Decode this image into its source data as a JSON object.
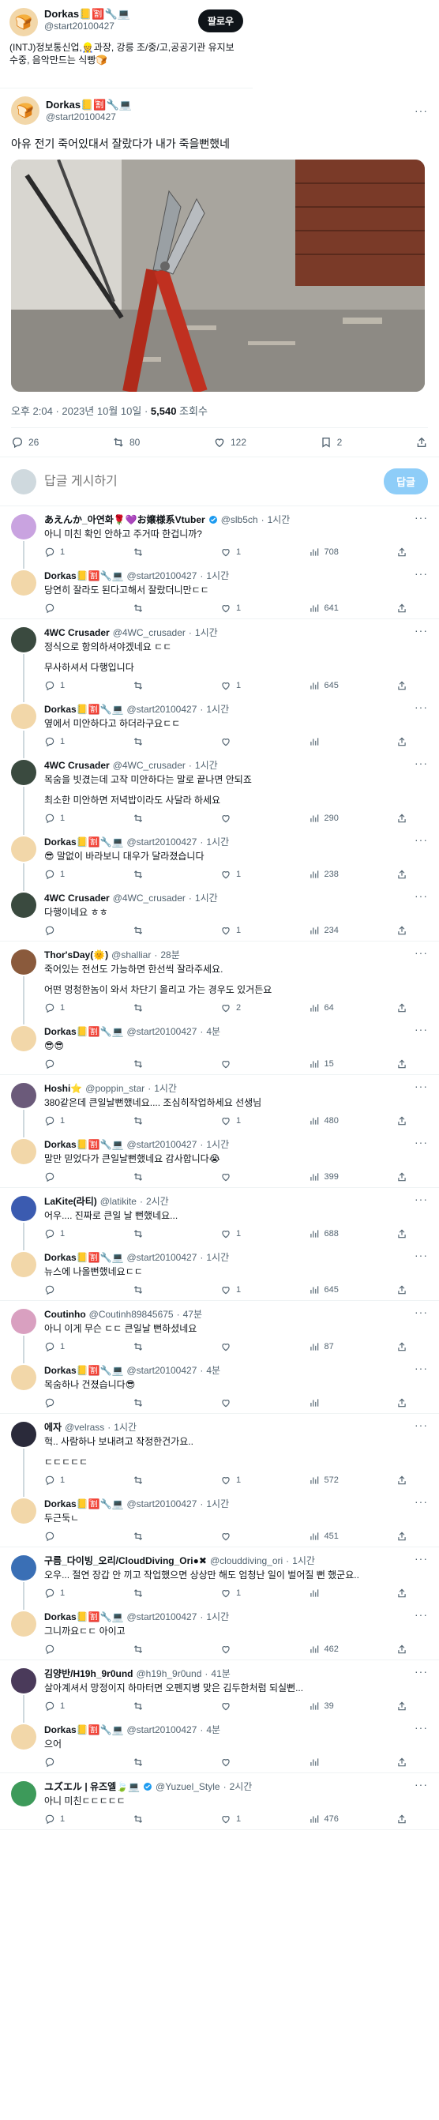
{
  "profile_card": {
    "name": "Dorkas📒🈹🔧💻",
    "handle": "@start20100427",
    "follow_label": "팔로우",
    "bio": "(INTJ)정보통신업,👷과장, 강릉 조/중/고,공공기관 유지보수중, 음악만드는 식빵🍞"
  },
  "main_tweet": {
    "name": "Dorkas📒🈹🔧💻",
    "handle": "@start20100427",
    "text": "아유 전기 죽어있대서 잘랐다가 내가 죽을뻔했네",
    "time": "오후 2:04 · 2023년 10월 10일 · ",
    "views": "5,540",
    "views_label": " 조회수",
    "stats": {
      "replies": "26",
      "retweets": "80",
      "likes": "122",
      "bookmarks": "2"
    }
  },
  "reply_box": {
    "placeholder": "답글 게시하기",
    "button": "답글"
  },
  "replies": [
    {
      "name": "あえんか_아연화🌹💜お嬢様系Vtuber",
      "verified": true,
      "handle": "@slb5ch",
      "time": "1시간",
      "body": [
        "아니 미친 확인 안하고 주거따 한겁니까?"
      ],
      "replies": "1",
      "retweets": "",
      "likes": "1",
      "views": "708",
      "color": "#c9a3e0",
      "threaded": true
    },
    {
      "name": "Dorkas📒🈹🔧💻",
      "verified": false,
      "handle": "@start20100427",
      "time": "1시간",
      "body": [
        "당연히 잘라도 된다고해서 잘랐더니만ㄷㄷ"
      ],
      "replies": "",
      "retweets": "",
      "likes": "1",
      "views": "641",
      "color": "#f2d7a9",
      "threaded": false
    },
    {
      "name": "4WC Crusader",
      "verified": false,
      "handle": "@4WC_crusader",
      "time": "1시간",
      "body": [
        "정식으로 항의하셔야겠네요 ㄷㄷ",
        "무사하셔서 다행입니다"
      ],
      "replies": "1",
      "retweets": "",
      "likes": "1",
      "views": "645",
      "color": "#3a4a3f",
      "threaded": true
    },
    {
      "name": "Dorkas📒🈹🔧💻",
      "verified": false,
      "handle": "@start20100427",
      "time": "1시간",
      "body": [
        "옆에서 미안하다고 하더라구요ㄷㄷ"
      ],
      "replies": "1",
      "retweets": "",
      "likes": "",
      "views": "",
      "color": "#f2d7a9",
      "threaded": true
    },
    {
      "name": "4WC Crusader",
      "verified": false,
      "handle": "@4WC_crusader",
      "time": "1시간",
      "body": [
        "목숨을 빗겼는데 고작 미안하다는 말로 끝나면 안되죠",
        "최소한 미안하면 저녁밥이라도 사달라 하세요"
      ],
      "replies": "1",
      "retweets": "",
      "likes": "",
      "views": "290",
      "color": "#3a4a3f",
      "threaded": true
    },
    {
      "name": "Dorkas📒🈹🔧💻",
      "verified": false,
      "handle": "@start20100427",
      "time": "1시간",
      "body": [
        "😎 말없이 바라보니 대우가 달라졌습니다"
      ],
      "replies": "1",
      "retweets": "",
      "likes": "1",
      "views": "238",
      "color": "#f2d7a9",
      "threaded": true
    },
    {
      "name": "4WC Crusader",
      "verified": false,
      "handle": "@4WC_crusader",
      "time": "1시간",
      "body": [
        "다행이네요 ㅎㅎ"
      ],
      "replies": "",
      "retweets": "",
      "likes": "1",
      "views": "234",
      "color": "#3a4a3f",
      "threaded": false
    },
    {
      "name": "Thor'sDay(🌞)",
      "verified": false,
      "handle": "@shalliar",
      "time": "28분",
      "body": [
        "죽어있는 전선도 가능하면 한선씩 잘라주세요.",
        "어떤 멍청한놈이 와서 차단기 올리고 가는 경우도 있거든요"
      ],
      "replies": "1",
      "retweets": "",
      "likes": "2",
      "views": "64",
      "color": "#8a5a3c",
      "threaded": true
    },
    {
      "name": "Dorkas📒🈹🔧💻",
      "verified": false,
      "handle": "@start20100427",
      "time": "4분",
      "body": [
        "😎😎"
      ],
      "replies": "",
      "retweets": "",
      "likes": "",
      "views": "15",
      "color": "#f2d7a9",
      "threaded": false
    },
    {
      "name": "Hoshi⭐",
      "verified": false,
      "handle": "@poppin_star",
      "time": "1시간",
      "body": [
        "380같은데 큰일날뻔했네요.... 조심히작업하세요 선생님"
      ],
      "replies": "1",
      "retweets": "",
      "likes": "1",
      "views": "480",
      "color": "#6b5a7a",
      "threaded": true
    },
    {
      "name": "Dorkas📒🈹🔧💻",
      "verified": false,
      "handle": "@start20100427",
      "time": "1시간",
      "body": [
        "말만 믿었다가 큰일날뻔했네요 감사합니다😭"
      ],
      "replies": "",
      "retweets": "",
      "likes": "",
      "views": "399",
      "color": "#f2d7a9",
      "threaded": false
    },
    {
      "name": "LaKite(라티)",
      "verified": false,
      "handle": "@latikite",
      "time": "2시간",
      "body": [
        "어우.... 진짜로 큰일 날 뻔했네요..."
      ],
      "replies": "1",
      "retweets": "",
      "likes": "1",
      "views": "688",
      "color": "#3b5bb0",
      "threaded": true
    },
    {
      "name": "Dorkas📒🈹🔧💻",
      "verified": false,
      "handle": "@start20100427",
      "time": "1시간",
      "body": [
        "뉴스에 나올뻔했네요ㄷㄷ"
      ],
      "replies": "",
      "retweets": "",
      "likes": "1",
      "views": "645",
      "color": "#f2d7a9",
      "threaded": false
    },
    {
      "name": "Coutinho",
      "verified": false,
      "handle": "@Coutinh89845675",
      "time": "47분",
      "body": [
        "아니 이게 무슨 ㄷㄷ 큰일날 뻔하셨네요"
      ],
      "replies": "1",
      "retweets": "",
      "likes": "",
      "views": "87",
      "color": "#d9a0c0",
      "threaded": true
    },
    {
      "name": "Dorkas📒🈹🔧💻",
      "verified": false,
      "handle": "@start20100427",
      "time": "4분",
      "body": [
        "목숨하나 건졌습니다😎"
      ],
      "replies": "",
      "retweets": "",
      "likes": "",
      "views": "",
      "color": "#f2d7a9",
      "threaded": false
    },
    {
      "name": "에자",
      "verified": false,
      "handle": "@velrass",
      "time": "1시간",
      "body": [
        "헉.. 사람하나 보내려고 작정한건가요..",
        "ㄷㄷㄷㄷㄷ"
      ],
      "replies": "1",
      "retweets": "",
      "likes": "1",
      "views": "572",
      "color": "#2a2a3a",
      "threaded": true
    },
    {
      "name": "Dorkas📒🈹🔧💻",
      "verified": false,
      "handle": "@start20100427",
      "time": "1시간",
      "body": [
        "두근둑ㄴ"
      ],
      "replies": "",
      "retweets": "",
      "likes": "",
      "views": "451",
      "color": "#f2d7a9",
      "threaded": false
    },
    {
      "name": "구름_다이빙_오리/CloudDiving_Ori●✖",
      "verified": false,
      "handle": "@clouddiving_ori",
      "time": "1시간",
      "body": [
        "오우... 절연 장갑 안 끼고 작업했으면 상상만 해도 엄청난 일이 벌어질 뻔 했군요.."
      ],
      "replies": "1",
      "retweets": "",
      "likes": "1",
      "views": "",
      "color": "#3a6fb5",
      "threaded": true
    },
    {
      "name": "Dorkas📒🈹🔧💻",
      "verified": false,
      "handle": "@start20100427",
      "time": "1시간",
      "body": [
        "그니까요ㄷㄷ 아이고"
      ],
      "replies": "",
      "retweets": "",
      "likes": "",
      "views": "462",
      "color": "#f2d7a9",
      "threaded": false
    },
    {
      "name": "김양반/H19h_9r0und",
      "verified": false,
      "handle": "@h19h_9r0und",
      "time": "41분",
      "body": [
        "살아계셔서 망정이지 하마터면 오펜지병 맞은 김두한처럼 되실뻔..."
      ],
      "replies": "1",
      "retweets": "",
      "likes": "",
      "views": "39",
      "color": "#4a3a5a",
      "threaded": true
    },
    {
      "name": "Dorkas📒🈹🔧💻",
      "verified": false,
      "handle": "@start20100427",
      "time": "4분",
      "body": [
        "으어"
      ],
      "replies": "",
      "retweets": "",
      "likes": "",
      "views": "",
      "color": "#f2d7a9",
      "threaded": false
    },
    {
      "name": "ユズエル | 유즈엘🍃💻",
      "verified": true,
      "handle": "@Yuzuel_Style",
      "time": "2시간",
      "body": [
        "아니 미친ㄷㄷㄷㄷㄷ"
      ],
      "replies": "1",
      "retweets": "",
      "likes": "1",
      "views": "476",
      "color": "#3d9a5a",
      "threaded": false
    }
  ],
  "colors": {
    "accent": "#1d9bf0",
    "muted": "#536471",
    "border": "#eff3f4"
  }
}
